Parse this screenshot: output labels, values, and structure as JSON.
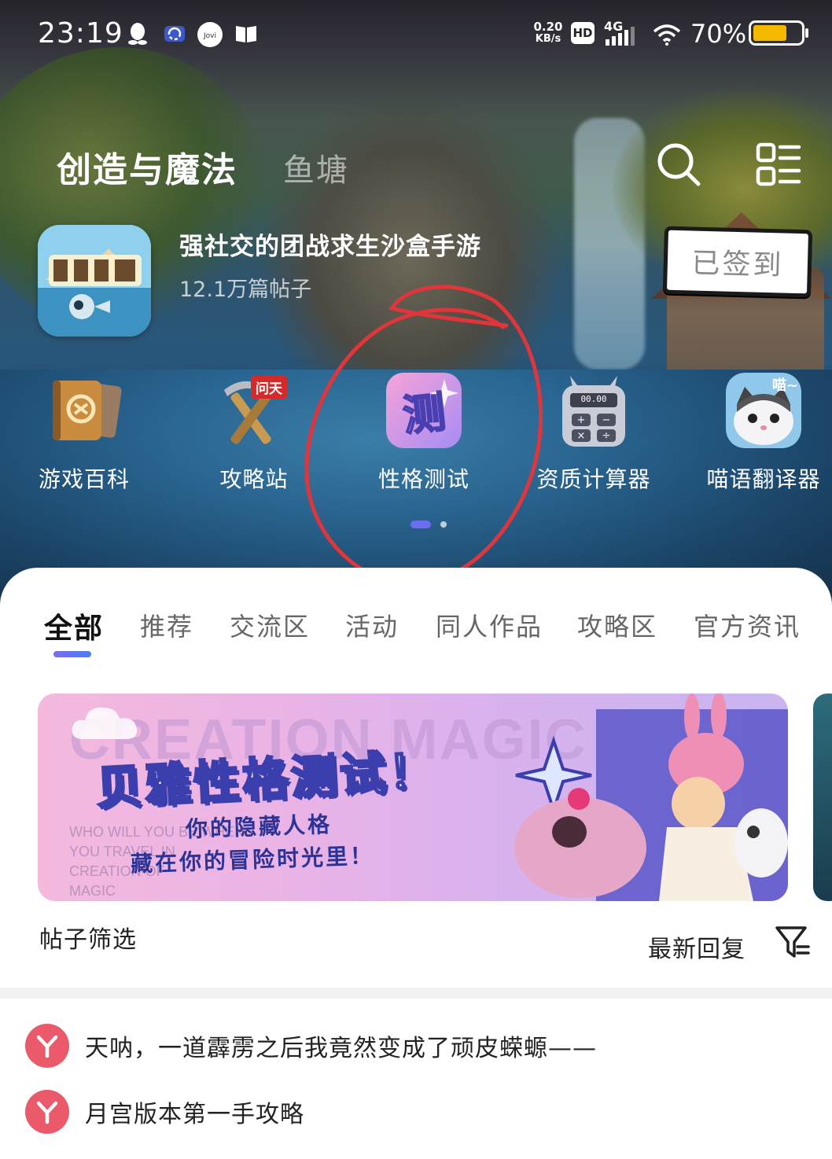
{
  "status_bar": {
    "time": "23:19",
    "net_speed_value": "0.20",
    "net_speed_unit": "KB/s",
    "hd": "HD",
    "network": "4G",
    "battery_percent": "70%",
    "battery_level": 0.7,
    "icons": [
      "qq-icon",
      "sync-app-icon",
      "jovi-icon",
      "book-icon",
      "wifi-icon",
      "signal-icon",
      "battery-icon"
    ]
  },
  "header": {
    "title": "创造与魔法",
    "secondary_tab": "鱼塘"
  },
  "game": {
    "description": "强社交的团战求生沙盒手游",
    "post_count": "12.1万篇帖子",
    "checkin_label": "已签到"
  },
  "tools": [
    {
      "label": "游戏百科",
      "icon": "encyclopedia-book-icon"
    },
    {
      "label": "攻略站",
      "icon": "pickaxe-icon",
      "badge": "问天"
    },
    {
      "label": "性格测试",
      "icon": "personality-test-icon",
      "glyph": "测"
    },
    {
      "label": "资质计算器",
      "icon": "calculator-icon",
      "display": "00.00"
    },
    {
      "label": "喵语翻译器",
      "icon": "cat-translator-icon",
      "caption": "喵~"
    }
  ],
  "pager": {
    "pages": 2,
    "current": 1
  },
  "tabs": [
    "全部",
    "推荐",
    "交流区",
    "活动",
    "同人作品",
    "攻略区",
    "官方资讯"
  ],
  "active_tab": "全部",
  "banner": {
    "bg_text": "CREATION MAGIC",
    "title": "贝雅性格测试！",
    "subtitle_1": "你的隐藏人格",
    "subtitle_2": "藏在你的冒险时光里！",
    "english_lines": [
      "WHO WILL YOU BE WHEN",
      "YOU TRAVEL IN",
      "CREATION OF",
      "MAGIC"
    ]
  },
  "filter": {
    "label": "帖子筛选",
    "sort": "最新回复"
  },
  "pinned_posts": [
    "天呐，一道霹雳之后我竟然变成了顽皮蝾螈——",
    "月宫版本第一手攻略"
  ],
  "colors": {
    "accent": "#6c6cf0",
    "pin": "#ea5a6a",
    "annotation": "#e0353a",
    "badge": "#d42a2a"
  }
}
